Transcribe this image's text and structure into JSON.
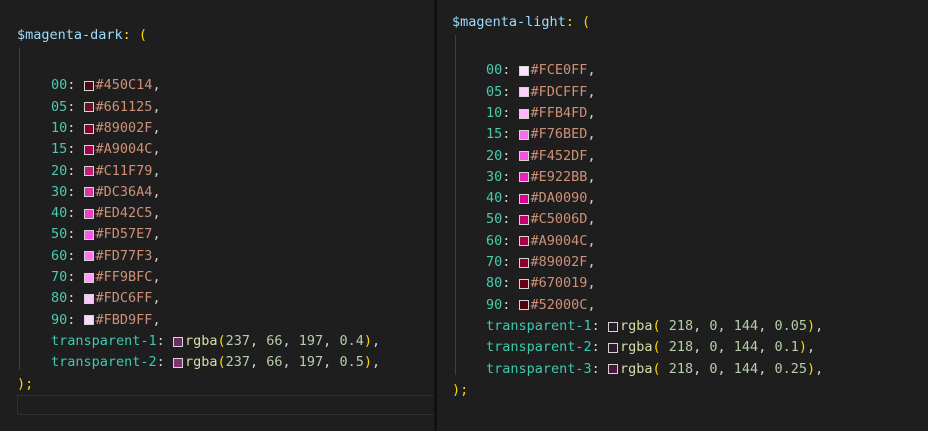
{
  "left": {
    "var_name": "$magenta-dark",
    "colon_open": ": (",
    "rows": [
      {
        "key": "00",
        "hex": "#450C14",
        "swatch": "#450C14"
      },
      {
        "key": "05",
        "hex": "#661125",
        "swatch": "#661125"
      },
      {
        "key": "10",
        "hex": "#89002F",
        "swatch": "#89002F"
      },
      {
        "key": "15",
        "hex": "#A9004C",
        "swatch": "#A9004C"
      },
      {
        "key": "20",
        "hex": "#C11F79",
        "swatch": "#C11F79"
      },
      {
        "key": "30",
        "hex": "#DC36A4",
        "swatch": "#DC36A4"
      },
      {
        "key": "40",
        "hex": "#ED42C5",
        "swatch": "#ED42C5"
      },
      {
        "key": "50",
        "hex": "#FD57E7",
        "swatch": "#FD57E7"
      },
      {
        "key": "60",
        "hex": "#FD77F3",
        "swatch": "#FD77F3"
      },
      {
        "key": "70",
        "hex": "#FF9BFC",
        "swatch": "#FF9BFC"
      },
      {
        "key": "80",
        "hex": "#FDC6FF",
        "swatch": "#FDC6FF"
      },
      {
        "key": "90",
        "hex": "#FBD9FF",
        "swatch": "#FBD9FF"
      }
    ],
    "transparent": [
      {
        "key": "transparent-1",
        "args": [
          "237",
          "66",
          "197",
          "0.4"
        ],
        "swatch": "rgba(237,66,197,0.4)"
      },
      {
        "key": "transparent-2",
        "args": [
          "237",
          "66",
          "197",
          "0.5"
        ],
        "swatch": "rgba(237,66,197,0.5)"
      }
    ],
    "close": ");"
  },
  "right": {
    "var_name": "$magenta-light",
    "colon_open": ": (",
    "rows": [
      {
        "key": "00",
        "hex": "#FCE0FF",
        "swatch": "#FCE0FF"
      },
      {
        "key": "05",
        "hex": "#FDCFFF",
        "swatch": "#FDCFFF"
      },
      {
        "key": "10",
        "hex": "#FFB4FD",
        "swatch": "#FFB4FD"
      },
      {
        "key": "15",
        "hex": "#F76BED",
        "swatch": "#F76BED"
      },
      {
        "key": "20",
        "hex": "#F452DF",
        "swatch": "#F452DF"
      },
      {
        "key": "30",
        "hex": "#E922BB",
        "swatch": "#E922BB"
      },
      {
        "key": "40",
        "hex": "#DA0090",
        "swatch": "#DA0090"
      },
      {
        "key": "50",
        "hex": "#C5006D",
        "swatch": "#C5006D"
      },
      {
        "key": "60",
        "hex": "#A9004C",
        "swatch": "#A9004C"
      },
      {
        "key": "70",
        "hex": "#89002F",
        "swatch": "#89002F"
      },
      {
        "key": "80",
        "hex": "#670019",
        "swatch": "#670019"
      },
      {
        "key": "90",
        "hex": "#52000C",
        "swatch": "#52000C"
      }
    ],
    "transparent": [
      {
        "key": "transparent-1",
        "args": [
          "218",
          "0",
          "144",
          "0.05"
        ],
        "swatch": "rgba(218,0,144,0.05)"
      },
      {
        "key": "transparent-2",
        "args": [
          "218",
          "0",
          "144",
          "0.1"
        ],
        "swatch": "rgba(218,0,144,0.1)"
      },
      {
        "key": "transparent-3",
        "args": [
          "218",
          "0",
          "144",
          "0.25"
        ],
        "swatch": "rgba(218,0,144,0.25)"
      }
    ],
    "close": ");"
  },
  "rgba_fn": "rgba"
}
